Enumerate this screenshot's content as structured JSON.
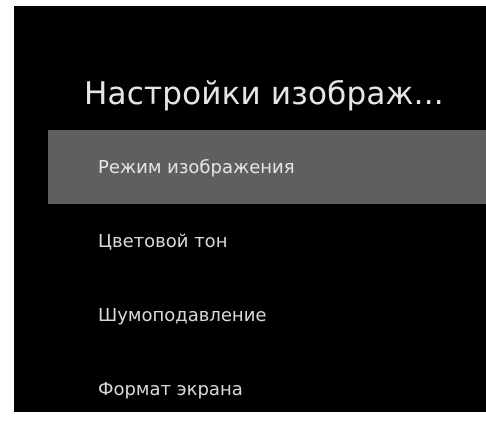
{
  "screen": {
    "title": "Настройки изображ..."
  },
  "menu": {
    "items": [
      {
        "label": "Режим изображения",
        "selected": true
      },
      {
        "label": "Цветовой тон",
        "selected": false
      },
      {
        "label": "Шумоподавление",
        "selected": false
      },
      {
        "label": "Формат экрана",
        "selected": false
      }
    ]
  },
  "colors": {
    "background": "#000000",
    "selected_item": "#5f5f5f",
    "text": "#e0e0e0"
  }
}
